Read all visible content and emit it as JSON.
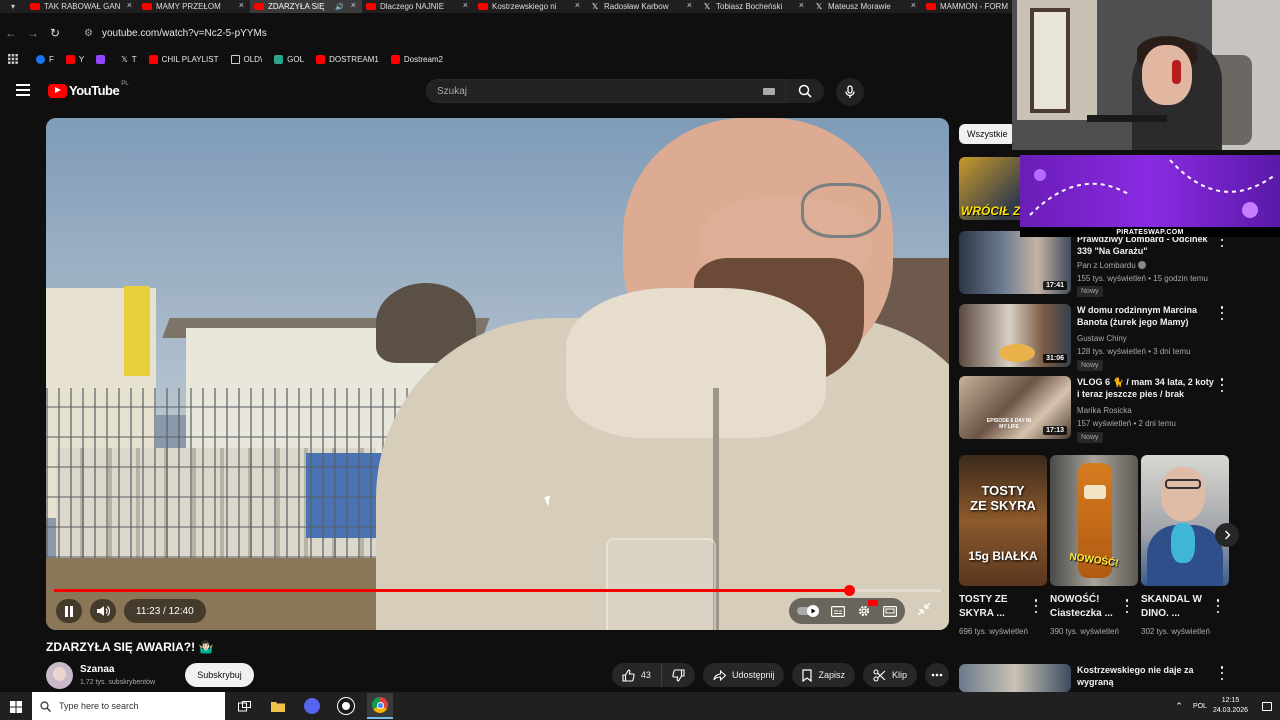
{
  "tabs": [
    {
      "label": "TAK RABOWAŁ GAN"
    },
    {
      "label": "MAMY PRZEŁOM"
    },
    {
      "label": "ZDARZYŁA SIĘ"
    },
    {
      "label": "Dlaczego NAJNIE"
    },
    {
      "label": "Kostrzewskiego ni"
    },
    {
      "label": "Radosław Karbow"
    },
    {
      "label": "Tobiasz Bocheński"
    },
    {
      "label": "Mateusz Morawie"
    },
    {
      "label": "MAMMON - FORM"
    }
  ],
  "address_bar": {
    "url": "youtube.com/watch?v=Nc2-5-pYYMs"
  },
  "bookmarks": [
    {
      "label": "F"
    },
    {
      "label": "Y"
    },
    {
      "label": ""
    },
    {
      "label": "T"
    },
    {
      "label": "CHIL PLAYLIST"
    },
    {
      "label": "OLD\\"
    },
    {
      "label": "GOL"
    },
    {
      "label": "DOSTREAM1"
    },
    {
      "label": "Dostream2"
    }
  ],
  "header": {
    "logo_text": "YouTube",
    "country_code": "PL",
    "search_placeholder": "Szukaj"
  },
  "player": {
    "time": "11:23 / 12:40",
    "progress": 0.896
  },
  "video": {
    "title": "ZDARZYŁA SIĘ AWARIA?! 🤷🏻‍♂️",
    "channel": "Szanaa",
    "subscribers": "1,72 tys. subskrybentów",
    "subscribe_label": "Subskrybuj",
    "likes": "43",
    "share_label": "Udostępnij",
    "save_label": "Zapisz",
    "clip_label": "Klip"
  },
  "chips": [
    {
      "label": "Wszystkie"
    }
  ],
  "recommendations": [
    {
      "thumb_text": "WRÓCIŁ Z"
    },
    {
      "title": "Prawdziwy Lombard - Odcinek 339 \"Na Garażu\"",
      "channel": "Pan z Lombardu",
      "meta": "155 tys. wyświetleń • 15 godzin temu",
      "badge": "Nowy",
      "duration": "17:41"
    },
    {
      "title": "W domu rodzinnym Marcina Banota (żurek jego Mamy)",
      "channel": "Gustaw Chiny",
      "meta": "128 tys. wyświetleń • 3 dni temu",
      "badge": "Nowy",
      "duration": "31:06"
    },
    {
      "title": "VLOG 6 🐈 / mam 34 lata, 2 koty i teraz jeszcze pies / brak czasu...",
      "channel": "Marika Rosicka",
      "meta": "157 wyświetleń • 2 dni temu",
      "badge": "Nowy",
      "duration": "17:13",
      "thumb_text": "EPISODE 6 DAY IN MY LIFE"
    },
    {
      "title": "Kostrzewskiego nie daje za wygraną",
      "channel": "",
      "meta": "",
      "badge": ""
    }
  ],
  "shorts": [
    {
      "title": "TOSTY ZE SKYRA ...",
      "views": "696 tys. wyświetleń",
      "thumb_line1": "TOSTY",
      "thumb_line2": "ZE SKYRA",
      "thumb_line3": "15g BIAŁKA"
    },
    {
      "title": "NOWOŚĆ! Ciasteczka ...",
      "views": "390 tys. wyświetleń",
      "thumb_line1": "NOWOŚĆ!"
    },
    {
      "title": "SKANDAL W DINO. ...",
      "views": "302 tys. wyświetleń"
    }
  ],
  "promo": {
    "text": "PIRATESWAP.COM"
  },
  "taskbar": {
    "search_placeholder": "Type here to search",
    "lang": "POL",
    "time": "12:15",
    "date": "24.03.2026"
  },
  "colors": {
    "accent": "#ff0000",
    "background": "#0f0f0f"
  }
}
